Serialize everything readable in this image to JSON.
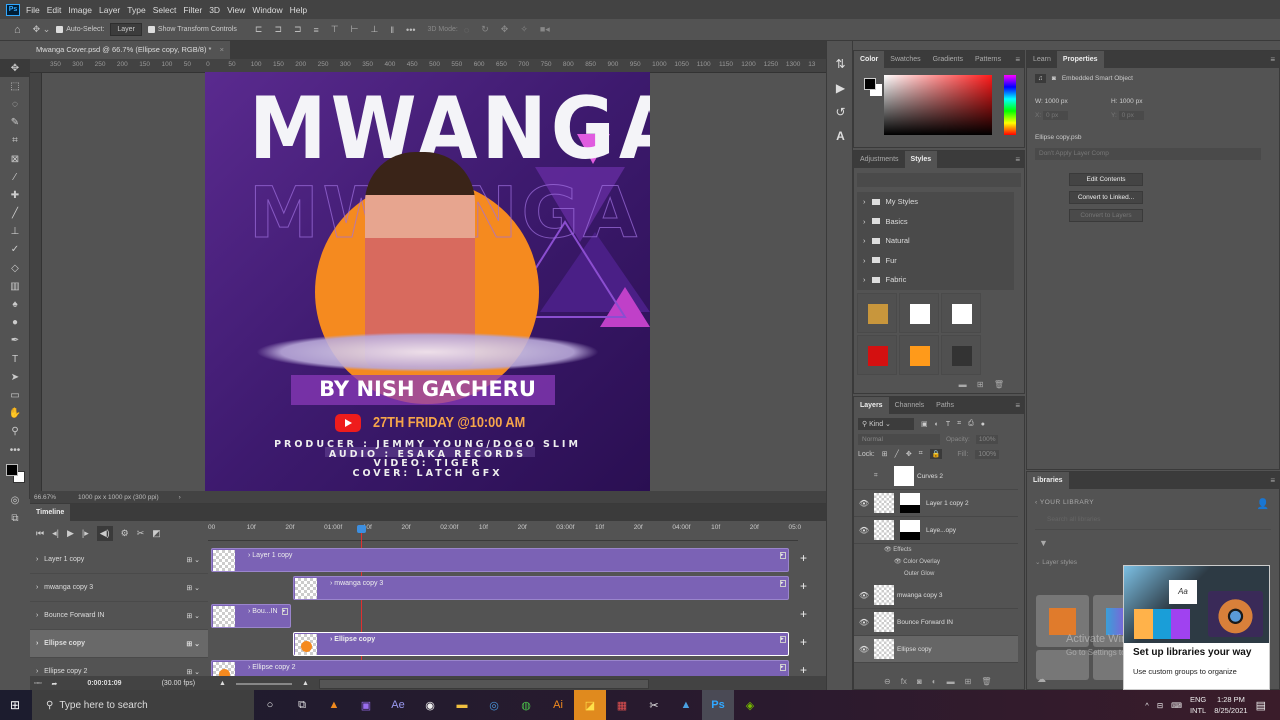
{
  "app": {
    "name": "Photoshop",
    "logo_text": "Ps"
  },
  "menu": [
    "File",
    "Edit",
    "Image",
    "Layer",
    "Type",
    "Select",
    "Filter",
    "3D",
    "View",
    "Window",
    "Help"
  ],
  "options_bar": {
    "auto_select_label": "Auto-Select:",
    "auto_select_value": "Layer",
    "show_transform_label": "Show Transform Controls",
    "mode_3d_label": "3D Mode:",
    "more_label": "•••"
  },
  "document_tab": {
    "title": "Mwanga Cover.psd @ 66.7% (Ellipse copy, RGB/8) *",
    "close": "×"
  },
  "ruler_top": [
    "350",
    "300",
    "250",
    "200",
    "150",
    "100",
    "50",
    "0",
    "50",
    "100",
    "150",
    "200",
    "250",
    "300",
    "350",
    "400",
    "450",
    "500",
    "550",
    "600",
    "650",
    "700",
    "750",
    "800",
    "850",
    "900",
    "950",
    "1000",
    "1050",
    "1100",
    "1150",
    "1200",
    "1250",
    "1300",
    "13"
  ],
  "artwork": {
    "title": "MWANGA",
    "artist": "BY NISH GACHERU",
    "date_line": "27TH FRIDAY @10:00 AM",
    "credits": [
      "PRODUCER : JEMMY YOUNG/DOGO SLIM",
      "AUDIO : ESAKA RECORDS",
      "VIDEO: TIGER",
      "COVER: LATCH GFX"
    ]
  },
  "status_bar": {
    "zoom": "66.67%",
    "doc_info": "1000 px x 1000 px (300 ppi)"
  },
  "timeline": {
    "tab": "Timeline",
    "ruler": [
      "00",
      "10f",
      "20f",
      "01:00f",
      "10f",
      "20f",
      "02:00f",
      "10f",
      "20f",
      "03:00f",
      "10f",
      "20f",
      "04:00f",
      "10f",
      "20f",
      "05:0"
    ],
    "tracks": [
      {
        "label": "Layer 1 copy",
        "clip": "Layer 1 copy",
        "selected": false
      },
      {
        "label": "mwanga copy 3",
        "clip": "mwanga copy 3",
        "selected": false
      },
      {
        "label": "Bounce Forward IN",
        "clip": "Bou...IN",
        "selected": false
      },
      {
        "label": "Ellipse copy",
        "clip": "Ellipse copy",
        "selected": true
      },
      {
        "label": "Ellipse copy 2",
        "clip": "Ellipse copy 2",
        "selected": false
      }
    ],
    "current_time": "0:00:01:09",
    "fps": "(30.00 fps)"
  },
  "color_panel": {
    "tabs": [
      "Color",
      "Swatches",
      "Gradients",
      "Patterns"
    ],
    "active": "Color",
    "hue_color": "#ff1a1a"
  },
  "styles_panel": {
    "tabs": [
      "Adjustments",
      "Styles"
    ],
    "active": "Styles",
    "folders": [
      "My Styles",
      "Basics",
      "Natural",
      "Fur",
      "Fabric"
    ],
    "swatches": [
      "#c8963c",
      "#ffffff",
      "#ffffff",
      "#d41010",
      "#ff9a1a",
      "#333333"
    ]
  },
  "layers_panel": {
    "tabs": [
      "Layers",
      "Channels",
      "Paths"
    ],
    "active": "Layers",
    "filter_kind": "Kind",
    "blend_mode": "Normal",
    "opacity_label": "Opacity:",
    "opacity": "100%",
    "lock_label": "Lock:",
    "fill_label": "Fill:",
    "fill": "100%",
    "layers": [
      {
        "name": "Curves 2",
        "visible": false
      },
      {
        "name": "Layer 1 copy 2",
        "visible": true
      },
      {
        "name": "Laye...opy",
        "visible": true
      },
      {
        "name": "mwanga copy 3",
        "visible": true
      },
      {
        "name": "Bounce Forward IN",
        "visible": true
      },
      {
        "name": "Ellipse copy",
        "visible": true
      }
    ],
    "effects_label": "Effects",
    "effects": [
      "Color Overlay",
      "Outer Glow"
    ]
  },
  "properties_panel": {
    "tabs": [
      "Learn",
      "Properties"
    ],
    "active": "Properties",
    "type": "Embedded Smart Object",
    "w_label": "W:",
    "w": "1000 px",
    "h_label": "H:",
    "h": "1000 px",
    "x_label": "X:",
    "x": "0 px",
    "y_label": "Y:",
    "y": "0 px",
    "filename": "Ellipse copy.psb",
    "layer_comp": "Don't Apply Layer Comp",
    "buttons": [
      "Edit Contents",
      "Convert to Linked...",
      "Convert to Layers"
    ]
  },
  "libraries_panel": {
    "tab": "Libraries",
    "back_label": "YOUR LIBRARY",
    "search_placeholder": "Search all libraries",
    "section": "Layer styles",
    "popup_title": "Set up libraries your way",
    "popup_text": "Use custom groups to organize"
  },
  "watermark": {
    "line1": "Activate Windows",
    "line2": "Go to Settings to activate Windows."
  },
  "taskbar": {
    "search_placeholder": "Type here to search",
    "lang1": "ENG",
    "lang2": "INTL",
    "time": "1:28 PM",
    "date": "8/25/2021"
  }
}
